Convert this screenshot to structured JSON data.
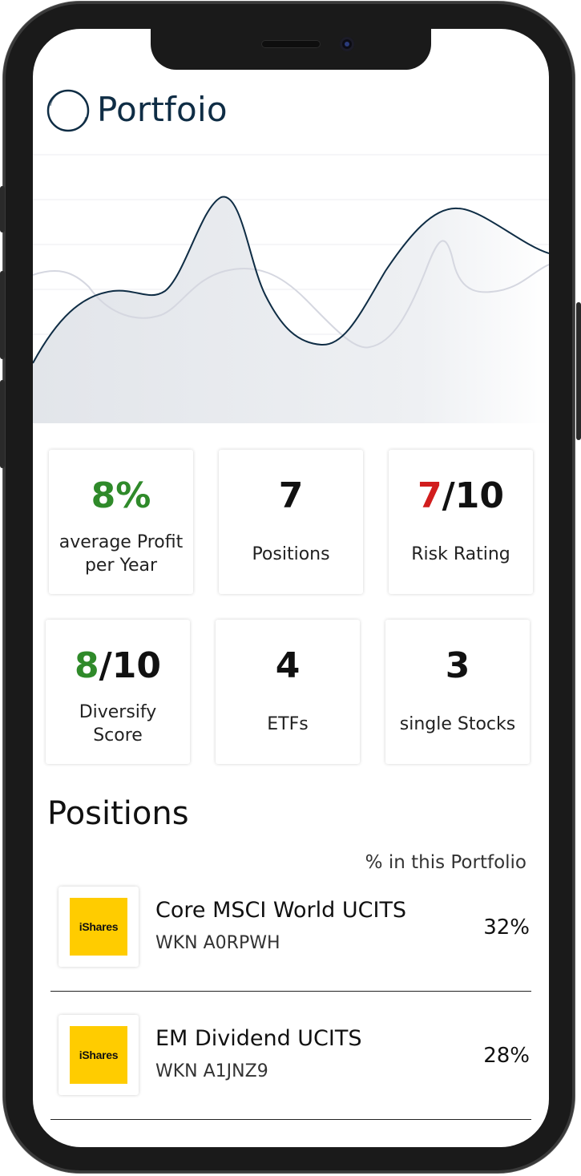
{
  "app": {
    "title": "Portfoio"
  },
  "chart": {
    "colors": {
      "primary_line": "#0f2d45",
      "secondary_line": "#d5d7e0",
      "fill": "#e6e8ec"
    }
  },
  "stats": [
    {
      "value_colored": "8%",
      "value_rest": "",
      "label": "average Profit per Year",
      "accent": "#2f8a2a"
    },
    {
      "value_colored": "",
      "value_rest": "7",
      "label": "Positions",
      "accent": ""
    },
    {
      "value_colored": "7",
      "value_rest": "/10",
      "label": "Risk Rating",
      "accent": "#d11d1d"
    },
    {
      "value_colored": "8",
      "value_rest": "/10",
      "label": "Diversify Score",
      "accent": "#2f8a2a"
    },
    {
      "value_colored": "",
      "value_rest": "4",
      "label": "ETFs",
      "accent": ""
    },
    {
      "value_colored": "",
      "value_rest": "3",
      "label": "single Stocks",
      "accent": ""
    }
  ],
  "positions_section": {
    "title": "Positions",
    "percent_header": "% in this Portfolio",
    "items": [
      {
        "logo_text": "iShares",
        "logo_icon": "ishares-logo",
        "name": "Core MSCI World UCITS",
        "wkn": "WKN A0RPWH",
        "percent": "32%"
      },
      {
        "logo_text": "iShares",
        "logo_icon": "ishares-logo",
        "name": "EM Dividend UCITS",
        "wkn": "WKN A1JNZ9",
        "percent": "28%"
      }
    ]
  }
}
